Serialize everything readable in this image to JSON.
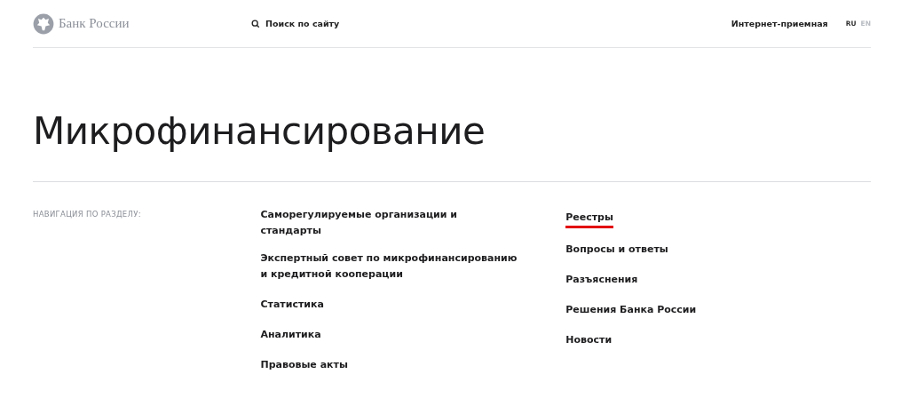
{
  "header": {
    "logo_text": "Банк России",
    "search": "Поиск по сайту",
    "reception": "Интернет-приемная",
    "languages": [
      {
        "label": "RU",
        "selected": true
      },
      {
        "label": "EN",
        "selected": false
      }
    ]
  },
  "title": "Микрофинансирование",
  "section_nav": {
    "label": "НАВИГАЦИЯ ПО РАЗДЕЛУ:",
    "columns": [
      [
        {
          "label": "Саморегулируемые организации и стандарты",
          "selected": false
        },
        {
          "label": "Экспертный совет по микрофинансированию и кредитной кооперации",
          "selected": false
        },
        {
          "label": "Статистика",
          "selected": false
        },
        {
          "label": "Аналитика",
          "selected": false
        },
        {
          "label": "Правовые акты",
          "selected": false
        }
      ],
      [
        {
          "label": "Реестры",
          "selected": true
        },
        {
          "label": "Вопросы и ответы",
          "selected": false
        },
        {
          "label": "Разъяснения",
          "selected": false
        },
        {
          "label": "Решения Банка России",
          "selected": false
        },
        {
          "label": "Новости",
          "selected": false
        }
      ]
    ]
  }
}
